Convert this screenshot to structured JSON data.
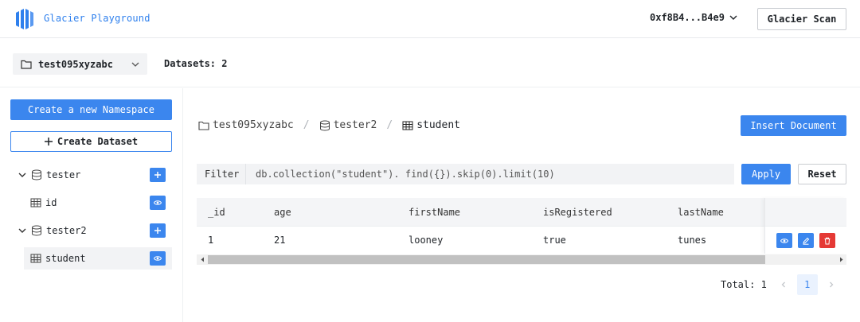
{
  "header": {
    "app_title": "Glacier Playground",
    "wallet_address": "0xf8B4...B4e9",
    "scan_button": "Glacier Scan"
  },
  "subheader": {
    "namespace": "test095xyzabc",
    "datasets_label": "Datasets: 2"
  },
  "sidebar": {
    "create_namespace": "Create a new Namespace",
    "create_dataset": "Create Dataset",
    "tree": [
      {
        "label": "tester",
        "children": [
          {
            "label": "id"
          }
        ]
      },
      {
        "label": "tester2",
        "children": [
          {
            "label": "student"
          }
        ]
      }
    ]
  },
  "main": {
    "breadcrumb": [
      "test095xyzabc",
      "tester2",
      "student"
    ],
    "insert_button": "Insert Document",
    "filter_label": "Filter",
    "filter_query": "db.collection(\"student\"). find({}).skip(0).limit(10)",
    "apply_button": "Apply",
    "reset_button": "Reset",
    "table": {
      "columns": [
        "_id",
        "age",
        "firstName",
        "isRegistered",
        "lastName"
      ],
      "rows": [
        [
          "1",
          "21",
          "looney",
          "true",
          "tunes"
        ]
      ]
    },
    "pagination": {
      "total_label": "Total: 1",
      "current_page": "1"
    }
  },
  "colors": {
    "accent": "#3b86ee",
    "danger": "#e53935"
  }
}
